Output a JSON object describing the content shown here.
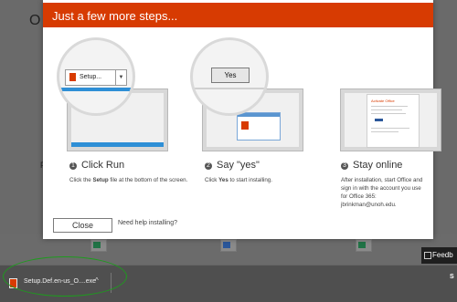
{
  "background": {
    "partial_heading": "O",
    "partial_text": "F",
    "file_tags": [
      {
        "letter": "X",
        "color": "#217346"
      },
      {
        "letter": "W",
        "color": "#2b579a"
      },
      {
        "letter": "X",
        "color": "#217346"
      }
    ]
  },
  "dialog": {
    "title": "Just a few more steps...",
    "accent_color": "#d73b02",
    "steps": [
      {
        "number": "1",
        "title": "Click Run",
        "desc_pre": "Click the ",
        "desc_bold": "Setup",
        "desc_post": " file at the bottom of the screen.",
        "zoom_button_label": "Setup..."
      },
      {
        "number": "2",
        "title": "Say \"yes\"",
        "desc_pre": "Click ",
        "desc_bold": "Yes",
        "desc_post": " to start installing.",
        "zoom_button_label": "Yes"
      },
      {
        "number": "3",
        "title": "Stay online",
        "desc": "After installation, start Office and sign in with the account you use for Office 365: jbrinkman@unoh.edu.",
        "card_title": "Activate Office"
      }
    ],
    "close_label": "Close",
    "help_link": "Need help installing?"
  },
  "download_bar": {
    "file_name": "Setup.Def.en-us_O....exe",
    "caret": "^",
    "annotation_color": "#1e9b1e"
  },
  "feedback_label": "Feedb",
  "show_all_label": "S"
}
